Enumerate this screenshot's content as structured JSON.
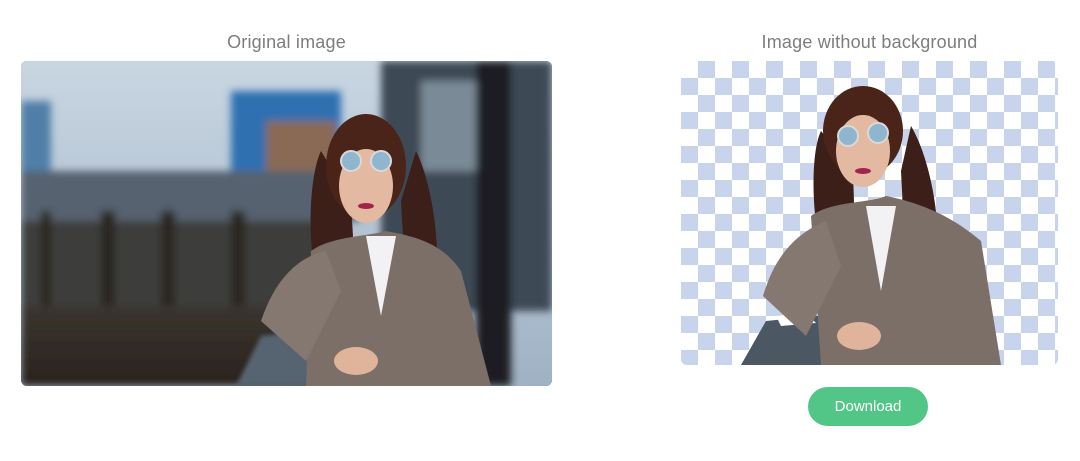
{
  "original": {
    "caption": "Original image"
  },
  "result": {
    "caption": "Image without background"
  },
  "actions": {
    "download_label": "Download"
  },
  "colors": {
    "accent": "#52c687",
    "checker": "#c8d3ec",
    "caption_text": "#7d7d7d"
  }
}
